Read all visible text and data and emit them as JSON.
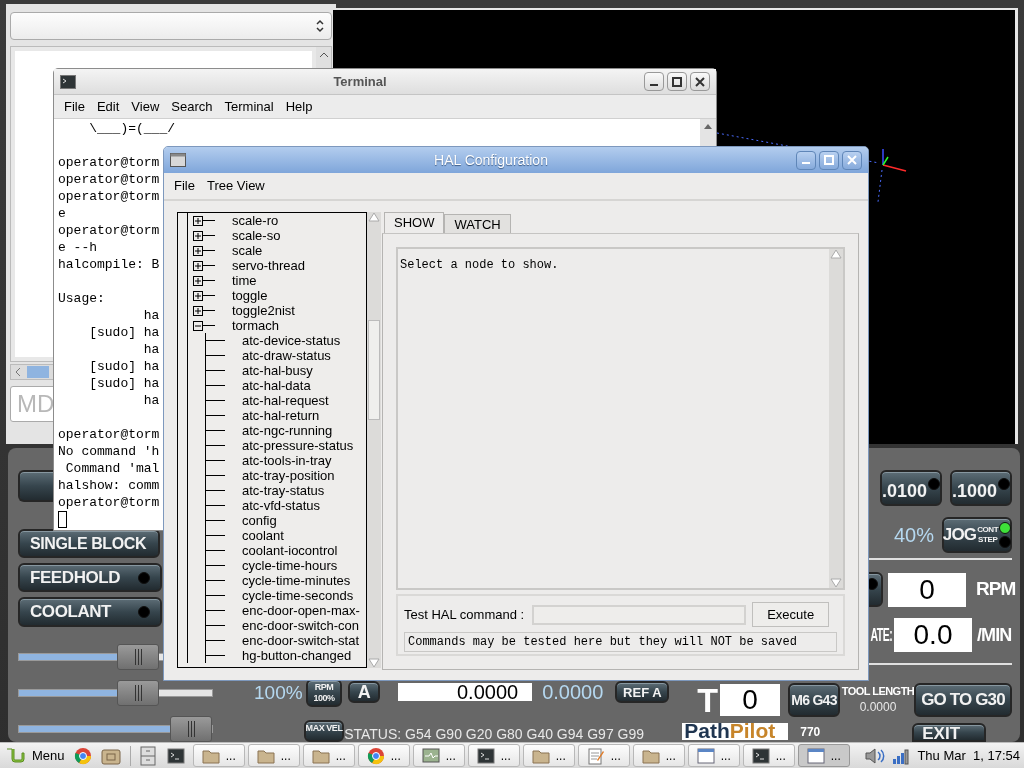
{
  "left_pane": {
    "mdi_field": {
      "placeholder": "MD"
    }
  },
  "terminal": {
    "title": "Terminal",
    "menu": [
      "File",
      "Edit",
      "View",
      "Search",
      "Terminal",
      "Help"
    ],
    "blocks": [
      [
        "    \\___)=(___/"
      ],
      [
        "operator@torm",
        "operator@torm",
        "operator@torm",
        "e",
        "operator@torm",
        "e --h",
        "halcompile: B"
      ],
      [
        "Usage:",
        "           ha",
        "    [sudo] ha",
        "           ha",
        "    [sudo] ha",
        "    [sudo] ha",
        "           ha"
      ],
      [
        "operator@torm",
        "No command 'h",
        " Command 'mal",
        "halshow: comm",
        "operator@torm"
      ]
    ],
    "cursor": true
  },
  "hal_window": {
    "title": "HAL Configuration",
    "menu": [
      "File",
      "Tree View"
    ],
    "tree": [
      {
        "label": "scale-ro",
        "expanded": false
      },
      {
        "label": "scale-so",
        "expanded": false
      },
      {
        "label": "scale",
        "expanded": false
      },
      {
        "label": "servo-thread",
        "expanded": false
      },
      {
        "label": "time",
        "expanded": false
      },
      {
        "label": "toggle",
        "expanded": false
      },
      {
        "label": "toggle2nist",
        "expanded": false
      },
      {
        "label": "tormach",
        "expanded": true,
        "children": [
          {
            "label": "atc-device-status"
          },
          {
            "label": "atc-draw-status"
          },
          {
            "label": "atc-hal-busy"
          },
          {
            "label": "atc-hal-data"
          },
          {
            "label": "atc-hal-request"
          },
          {
            "label": "atc-hal-return"
          },
          {
            "label": "atc-ngc-running"
          },
          {
            "label": "atc-pressure-status"
          },
          {
            "label": "atc-tools-in-tray"
          },
          {
            "label": "atc-tray-position"
          },
          {
            "label": "atc-tray-status"
          },
          {
            "label": "atc-vfd-status"
          },
          {
            "label": "config"
          },
          {
            "label": "coolant"
          },
          {
            "label": "coolant-iocontrol"
          },
          {
            "label": "cycle-time-hours"
          },
          {
            "label": "cycle-time-minutes"
          },
          {
            "label": "cycle-time-seconds"
          },
          {
            "label": "enc-door-open-max-"
          },
          {
            "label": "enc-door-switch-con"
          },
          {
            "label": "enc-door-switch-stat"
          },
          {
            "label": "hg-button-changed"
          }
        ]
      }
    ],
    "tabs": [
      {
        "label": "SHOW",
        "selected": true
      },
      {
        "label": "WATCH",
        "selected": false
      }
    ],
    "show_text": "Select a node to show.",
    "test_command": {
      "label": "Test HAL command :",
      "button": "Execute",
      "note": "Commands may be tested here but they will NOT be saved"
    }
  },
  "control_panel": {
    "left_buttons": [
      {
        "kind": "covered"
      },
      {
        "kind": "plain",
        "label": "SINGLE BLOCK"
      },
      {
        "kind": "led",
        "label": "FEEDHOLD",
        "led_on": false
      },
      {
        "kind": "led",
        "label": "COOLANT",
        "led_on": false
      }
    ],
    "sliders": [
      {
        "level": 0.65
      },
      {
        "level": 0.65,
        "reading": "100%",
        "button": [
          "RPM",
          "100%"
        ]
      },
      {
        "level": 1.0,
        "button": [
          "MAX VEL"
        ]
      }
    ],
    "axis_a": {
      "label": "A",
      "value": "0.0000",
      "reading": "0.0000",
      "ref": "REF A"
    },
    "status": "STATUS: G54 G90 G20 G80 G40 G94 G97 G99",
    "step_buttons": [
      {
        "label": ".0100",
        "led_on": false
      },
      {
        "label": ".1000",
        "led_on": false
      }
    ],
    "jog": {
      "reading": "40%",
      "label": "JOG",
      "modes": [
        {
          "label": "CONT",
          "led_on": true
        },
        {
          "label": "STEP",
          "led_on": false
        }
      ]
    },
    "spindle": {
      "led_on": false,
      "value": "0",
      "unit": "RPM"
    },
    "feed": {
      "label": "ATE:",
      "value": "0.0",
      "unit": "/MIN"
    },
    "tool": {
      "label": "T",
      "value": "0",
      "button": "M6 G43",
      "length_label": "TOOL LENGTH",
      "length": "0.0000",
      "goto": "GO TO G30"
    },
    "logo": [
      {
        "kind": "dark",
        "text": "Path"
      },
      {
        "kind": "accent",
        "text": "Pilot"
      }
    ],
    "model": "770",
    "exit": "EXIT"
  },
  "taskbar": {
    "menu": "Menu",
    "launchers": [
      {
        "kind": "browser"
      },
      {
        "kind": "files"
      }
    ],
    "quick": [
      {
        "kind": "cabinet"
      },
      {
        "kind": "terminal"
      }
    ],
    "tasks": [
      {
        "kind": "folder",
        "label": "...",
        "selected": false
      },
      {
        "kind": "folder",
        "label": "...",
        "selected": false
      },
      {
        "kind": "folder",
        "label": "...",
        "selected": false
      },
      {
        "kind": "browser",
        "label": "...",
        "selected": false
      },
      {
        "kind": "monitor",
        "label": "...",
        "selected": false
      },
      {
        "kind": "terminal",
        "label": "...",
        "selected": false
      },
      {
        "kind": "folder",
        "label": "...",
        "selected": false
      },
      {
        "kind": "notepad",
        "label": "...",
        "selected": false
      },
      {
        "kind": "folder",
        "label": "...",
        "selected": false
      },
      {
        "kind": "window",
        "label": "...",
        "selected": false
      },
      {
        "kind": "terminal",
        "label": "...",
        "selected": false
      },
      {
        "kind": "window",
        "label": "...",
        "selected": true
      }
    ],
    "clock": "Thu Mar  1, 17:54"
  }
}
